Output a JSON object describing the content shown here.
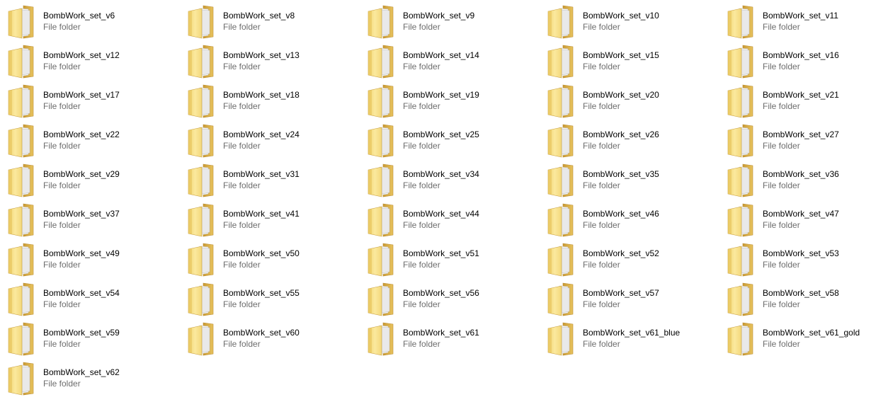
{
  "folder_type_label": "File folder",
  "colors": {
    "folder_back": "#d9b04a",
    "folder_front": "#f7e08a",
    "folder_paper": "#f4f4f4",
    "type_text": "#6d6d6d"
  },
  "items": [
    {
      "name": "BombWork_set_v6",
      "type": "File folder",
      "icon": "folder-icon"
    },
    {
      "name": "BombWork_set_v8",
      "type": "File folder",
      "icon": "folder-icon"
    },
    {
      "name": "BombWork_set_v9",
      "type": "File folder",
      "icon": "folder-icon"
    },
    {
      "name": "BombWork_set_v10",
      "type": "File folder",
      "icon": "folder-icon"
    },
    {
      "name": "BombWork_set_v11",
      "type": "File folder",
      "icon": "folder-icon"
    },
    {
      "name": "BombWork_set_v12",
      "type": "File folder",
      "icon": "folder-icon"
    },
    {
      "name": "BombWork_set_v13",
      "type": "File folder",
      "icon": "folder-icon"
    },
    {
      "name": "BombWork_set_v14",
      "type": "File folder",
      "icon": "folder-icon"
    },
    {
      "name": "BombWork_set_v15",
      "type": "File folder",
      "icon": "folder-icon"
    },
    {
      "name": "BombWork_set_v16",
      "type": "File folder",
      "icon": "folder-icon"
    },
    {
      "name": "BombWork_set_v17",
      "type": "File folder",
      "icon": "folder-icon"
    },
    {
      "name": "BombWork_set_v18",
      "type": "File folder",
      "icon": "folder-icon"
    },
    {
      "name": "BombWork_set_v19",
      "type": "File folder",
      "icon": "folder-icon"
    },
    {
      "name": "BombWork_set_v20",
      "type": "File folder",
      "icon": "folder-icon"
    },
    {
      "name": "BombWork_set_v21",
      "type": "File folder",
      "icon": "folder-icon"
    },
    {
      "name": "BombWork_set_v22",
      "type": "File folder",
      "icon": "folder-icon"
    },
    {
      "name": "BombWork_set_v24",
      "type": "File folder",
      "icon": "folder-icon"
    },
    {
      "name": "BombWork_set_v25",
      "type": "File folder",
      "icon": "folder-icon"
    },
    {
      "name": "BombWork_set_v26",
      "type": "File folder",
      "icon": "folder-icon"
    },
    {
      "name": "BombWork_set_v27",
      "type": "File folder",
      "icon": "folder-icon"
    },
    {
      "name": "BombWork_set_v29",
      "type": "File folder",
      "icon": "folder-icon"
    },
    {
      "name": "BombWork_set_v31",
      "type": "File folder",
      "icon": "folder-icon"
    },
    {
      "name": "BombWork_set_v34",
      "type": "File folder",
      "icon": "folder-icon"
    },
    {
      "name": "BombWork_set_v35",
      "type": "File folder",
      "icon": "folder-icon"
    },
    {
      "name": "BombWork_set_v36",
      "type": "File folder",
      "icon": "folder-icon"
    },
    {
      "name": "BombWork_set_v37",
      "type": "File folder",
      "icon": "folder-icon"
    },
    {
      "name": "BombWork_set_v41",
      "type": "File folder",
      "icon": "folder-icon"
    },
    {
      "name": "BombWork_set_v44",
      "type": "File folder",
      "icon": "folder-icon"
    },
    {
      "name": "BombWork_set_v46",
      "type": "File folder",
      "icon": "folder-icon"
    },
    {
      "name": "BombWork_set_v47",
      "type": "File folder",
      "icon": "folder-icon"
    },
    {
      "name": "BombWork_set_v49",
      "type": "File folder",
      "icon": "folder-icon"
    },
    {
      "name": "BombWork_set_v50",
      "type": "File folder",
      "icon": "folder-icon"
    },
    {
      "name": "BombWork_set_v51",
      "type": "File folder",
      "icon": "folder-icon"
    },
    {
      "name": "BombWork_set_v52",
      "type": "File folder",
      "icon": "folder-icon"
    },
    {
      "name": "BombWork_set_v53",
      "type": "File folder",
      "icon": "folder-icon"
    },
    {
      "name": "BombWork_set_v54",
      "type": "File folder",
      "icon": "folder-icon"
    },
    {
      "name": "BombWork_set_v55",
      "type": "File folder",
      "icon": "folder-icon"
    },
    {
      "name": "BombWork_set_v56",
      "type": "File folder",
      "icon": "folder-icon"
    },
    {
      "name": "BombWork_set_v57",
      "type": "File folder",
      "icon": "folder-icon"
    },
    {
      "name": "BombWork_set_v58",
      "type": "File folder",
      "icon": "folder-icon"
    },
    {
      "name": "BombWork_set_v59",
      "type": "File folder",
      "icon": "folder-icon"
    },
    {
      "name": "BombWork_set_v60",
      "type": "File folder",
      "icon": "folder-icon"
    },
    {
      "name": "BombWork_set_v61",
      "type": "File folder",
      "icon": "folder-icon"
    },
    {
      "name": "BombWork_set_v61_blue",
      "type": "File folder",
      "icon": "folder-icon"
    },
    {
      "name": "BombWork_set_v61_gold",
      "type": "File folder",
      "icon": "folder-icon"
    },
    {
      "name": "BombWork_set_v62",
      "type": "File folder",
      "icon": "folder-icon"
    }
  ]
}
